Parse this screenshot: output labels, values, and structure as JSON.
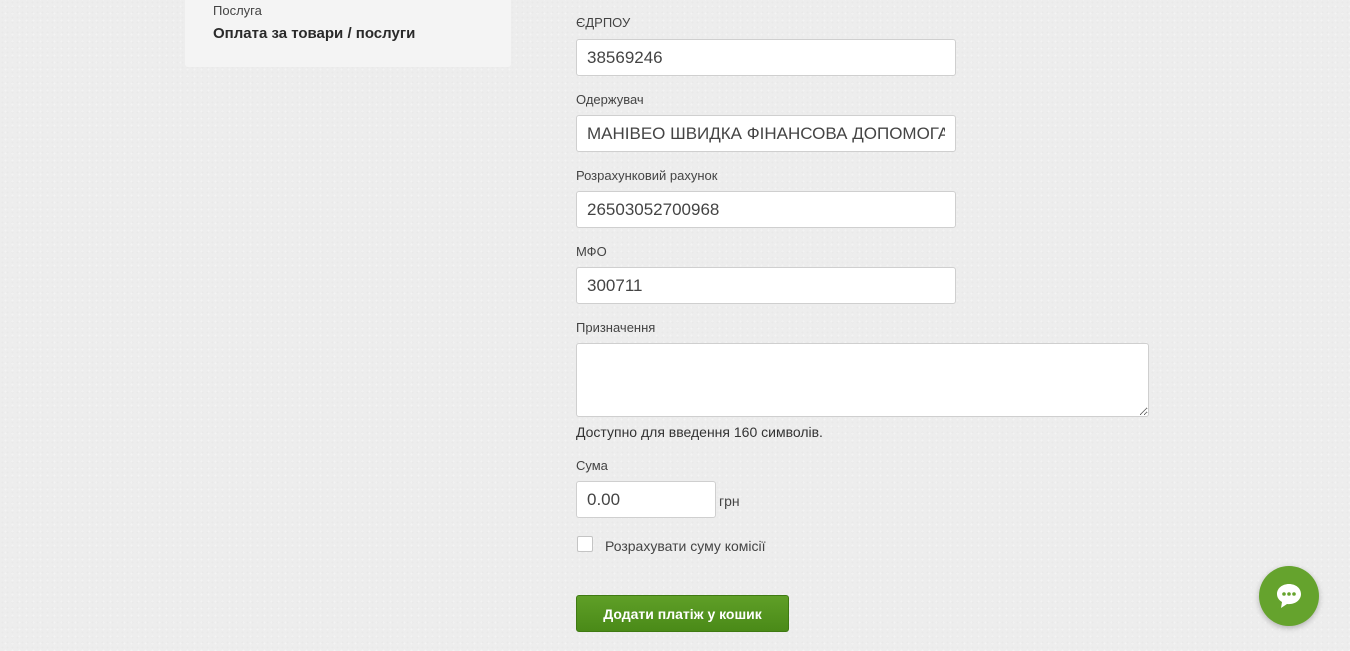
{
  "service": {
    "label": "Послуга",
    "name": "Оплата за товари / послуги"
  },
  "form": {
    "edrpou": {
      "label": "ЄДРПОУ",
      "value": "38569246"
    },
    "recipient": {
      "label": "Одержувач",
      "value": "МАНІВЕО ШВИДКА ФІНАНСОВА ДОПОМОГА"
    },
    "account": {
      "label": "Розрахунковий рахунок",
      "value": "26503052700968"
    },
    "mfo": {
      "label": "МФО",
      "value": "300711"
    },
    "purpose": {
      "label": "Призначення",
      "value": "",
      "hint": "Доступно для введення 160 символів."
    },
    "amount": {
      "label": "Сума",
      "value": "0.00",
      "currency": "грн"
    },
    "commission": {
      "label": "Розрахувати суму комісії",
      "checked": false
    },
    "submit_label": "Додати платіж у кошик"
  },
  "chat": {
    "icon": "chat-bubble-icon",
    "color": "#65a32d"
  },
  "colors": {
    "accent": "#4f8f1c"
  }
}
